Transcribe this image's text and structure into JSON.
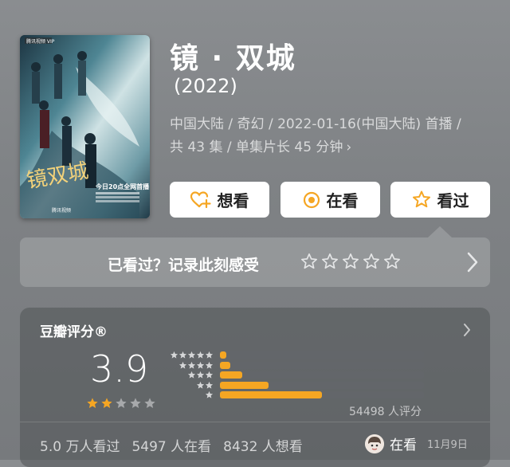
{
  "movie": {
    "title": "镜 · 双城",
    "year": "(2022)",
    "meta_line1": "中国大陆 / 奇幻 / 2022-01-16(中国大陆) 首播 /",
    "meta_line2": "共 43 集 / 单集片长 45 分钟",
    "meta_chevron": "›",
    "poster": {
      "badge": "腾讯视频 VIP",
      "calligraphy": "镜双城",
      "tagline": "今日20点全网首播",
      "platform": "腾讯视频"
    }
  },
  "actions": {
    "want_label": "想看",
    "watching_label": "在看",
    "watched_label": "看过"
  },
  "rate_prompt": {
    "text": "已看过？记录此刻感受",
    "chevron": "›"
  },
  "score": {
    "title": "豆瓣评分®",
    "value": "3.9",
    "stars_filled": 2,
    "stars_total": 5,
    "distribution": [
      {
        "stars": 5,
        "percent": 3
      },
      {
        "stars": 4,
        "percent": 5
      },
      {
        "stars": 3,
        "percent": 11
      },
      {
        "stars": 2,
        "percent": 24
      },
      {
        "stars": 1,
        "percent": 50
      }
    ],
    "count": "54498 人评分",
    "chevron": "›"
  },
  "stats": {
    "watched": "5.0 万人看过",
    "watching": "5497 人在看",
    "want": "8432 人想看"
  },
  "friend": {
    "status": "在看",
    "date": "11月9日"
  },
  "colors": {
    "accent_orange": "#f5a623",
    "bar_track": "#63666a",
    "star_empty": "#a7a9ab",
    "button_bg": "#ffffff"
  }
}
